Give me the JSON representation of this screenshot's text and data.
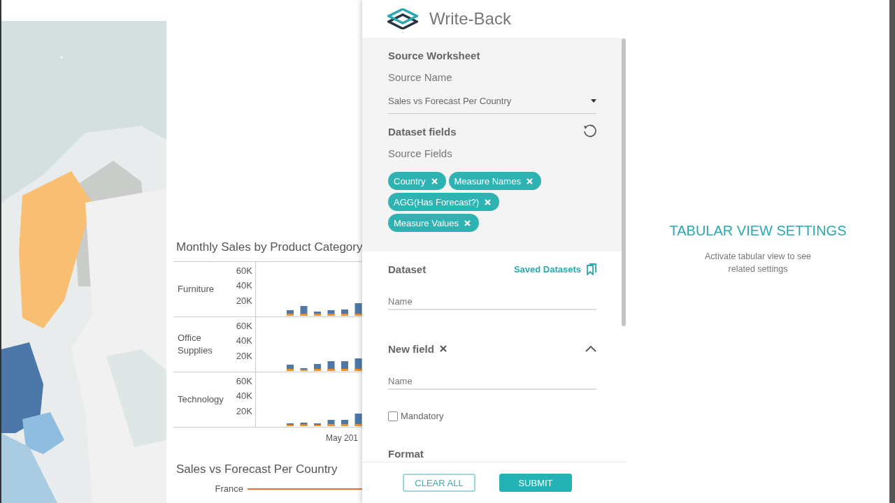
{
  "dashboard": {
    "sales_chart": {
      "title": "Monthly Sales by Product Category",
      "rows": [
        {
          "label": "Furniture",
          "ticks": [
            "60K",
            "40K",
            "20K"
          ]
        },
        {
          "label": "Office Supplies",
          "ticks": [
            "60K",
            "40K",
            "20K"
          ]
        },
        {
          "label": "Technology",
          "ticks": [
            "60K",
            "40K",
            "20K"
          ]
        }
      ],
      "axis_label": "May 201"
    },
    "forecast_chart": {
      "title": "Sales vs Forecast Per Country",
      "rows": [
        "France"
      ]
    }
  },
  "panel": {
    "app_title": "Write-Back",
    "source": {
      "heading": "Source Worksheet",
      "label": "Source Name",
      "value": "Sales vs Forecast Per Country"
    },
    "dataset_fields": {
      "heading": "Dataset fields",
      "label": "Source Fields",
      "chips": [
        "Country",
        "Measure Names",
        "AGG(Has Forecast?)",
        "Measure Values"
      ]
    },
    "dataset": {
      "heading": "Dataset",
      "link": "Saved Datasets",
      "placeholder": "Name"
    },
    "new_field": {
      "heading": "New field",
      "expanded": true,
      "placeholder": "Name",
      "mandatory": {
        "label": "Mandatory",
        "checked": false
      }
    },
    "format_heading": "Format",
    "buttons": [
      {
        "label": "CLEAR ALL",
        "kind": "outline"
      },
      {
        "label": "SUBMIT",
        "kind": "primary"
      }
    ]
  },
  "tabular": {
    "title": "TABULAR VIEW SETTINGS",
    "message": "Activate tabular view to see related settings"
  }
}
